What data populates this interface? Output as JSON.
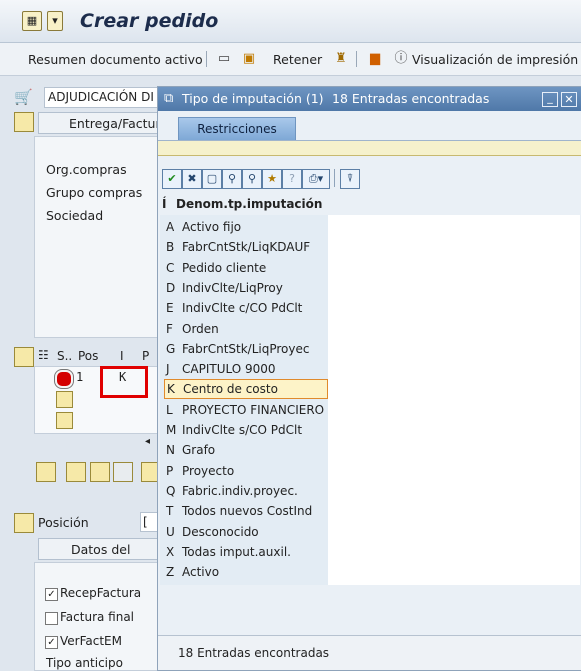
{
  "window": {
    "title": "Crear pedido"
  },
  "toolbar": {
    "summary_label": "Resumen documento activo",
    "hold_label": "Retener",
    "print_preview_label": "Visualización de impresión"
  },
  "header": {
    "doc_type_value": "ADJUDICACIÓN DI",
    "tab_delivery": "Entrega/Factur",
    "labels": {
      "purch_org": "Org.compras",
      "purch_group": "Grupo compras",
      "company": "Sociedad"
    }
  },
  "items": {
    "columns": {
      "status": "S..",
      "pos": "Pos",
      "acct": "I",
      "p": "P"
    },
    "row1": {
      "pos": "1",
      "acct": "K"
    }
  },
  "item_detail": {
    "position_label": "Posición",
    "position_value": "[",
    "tab_material": "Datos del mate",
    "checkboxes": [
      {
        "label": "RecepFactura",
        "checked": "✓"
      },
      {
        "label": "Factura final",
        "checked": ""
      },
      {
        "label": "VerFactEM",
        "checked": "✓"
      }
    ],
    "advance_label": "Tipo anticipo"
  },
  "popup": {
    "title": "Tipo de imputación (1)",
    "count_title": "18 Entradas encontradas",
    "tab_restrictions": "Restricciones",
    "column_header": "Denom.tp.imputación",
    "column_marker": "Í",
    "selected_index": 11,
    "entries": [
      {
        "key": "A",
        "text": "Activo fijo"
      },
      {
        "key": "B",
        "text": "FabrCntStk/LiqKDAUF"
      },
      {
        "key": "C",
        "text": "Pedido cliente"
      },
      {
        "key": "D",
        "text": "IndivClte/LiqProy"
      },
      {
        "key": "E",
        "text": "IndivClte c/CO PdClt"
      },
      {
        "key": "F",
        "text": "Orden"
      },
      {
        "key": "G",
        "text": "FabrCntStk/LiqProyec"
      },
      {
        "key": "J",
        "text": "CAPITULO 9000"
      },
      {
        "key": "K",
        "text": "Centro de costo"
      },
      {
        "key": "L",
        "text": "PROYECTO FINANCIERO"
      },
      {
        "key": "M",
        "text": "IndivClte s/CO PdClt"
      },
      {
        "key": "N",
        "text": "Grafo"
      },
      {
        "key": "P",
        "text": "Proyecto"
      },
      {
        "key": "Q",
        "text": "Fabric.indiv.proyec."
      },
      {
        "key": "T",
        "text": "Todos nuevos CostInd"
      },
      {
        "key": "U",
        "text": "Desconocido"
      },
      {
        "key": "X",
        "text": "Todas imput.auxil."
      },
      {
        "key": "Z",
        "text": "Activo"
      }
    ],
    "footer": "18 Entradas encontradas"
  }
}
